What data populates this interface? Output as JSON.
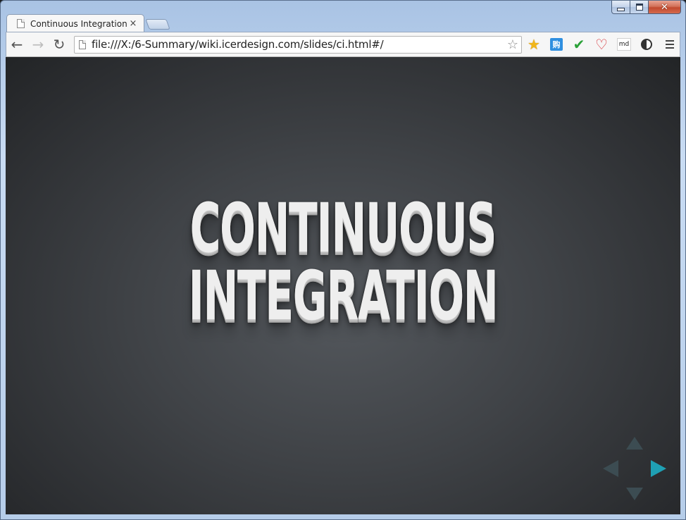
{
  "browser": {
    "tab": {
      "title": "Continuous Integration",
      "close_glyph": "×"
    },
    "window_controls": {
      "close_glyph": "✕"
    },
    "toolbar": {
      "back_glyph": "←",
      "forward_glyph": "→",
      "reload_glyph": "↻",
      "url": "file:///X:/6-Summary/wiki.icerdesign.com/slides/ci.html#/",
      "bookmark_glyph": "☆"
    },
    "extensions": [
      {
        "name": "star-extension",
        "glyph": "★",
        "color": "#f1b619"
      },
      {
        "name": "translate-extension",
        "glyph": "购",
        "color": "#2f8fe0"
      },
      {
        "name": "check-extension",
        "glyph": "✔",
        "color": "#2aa138"
      },
      {
        "name": "heart-extension",
        "glyph": "♡",
        "color": "#d4252b"
      },
      {
        "name": "markdown-extension",
        "glyph": "md",
        "color": "#222222"
      },
      {
        "name": "contrast-extension",
        "glyph": "",
        "color": "#333333"
      }
    ]
  },
  "slide": {
    "title_line1": "CONTINUOUS",
    "title_line2": "INTEGRATION",
    "accent_color": "#1fa0b4",
    "background_color": "#3f4246"
  },
  "navigation": {
    "active_direction": "right",
    "directions": [
      "up",
      "left",
      "right",
      "down"
    ]
  }
}
